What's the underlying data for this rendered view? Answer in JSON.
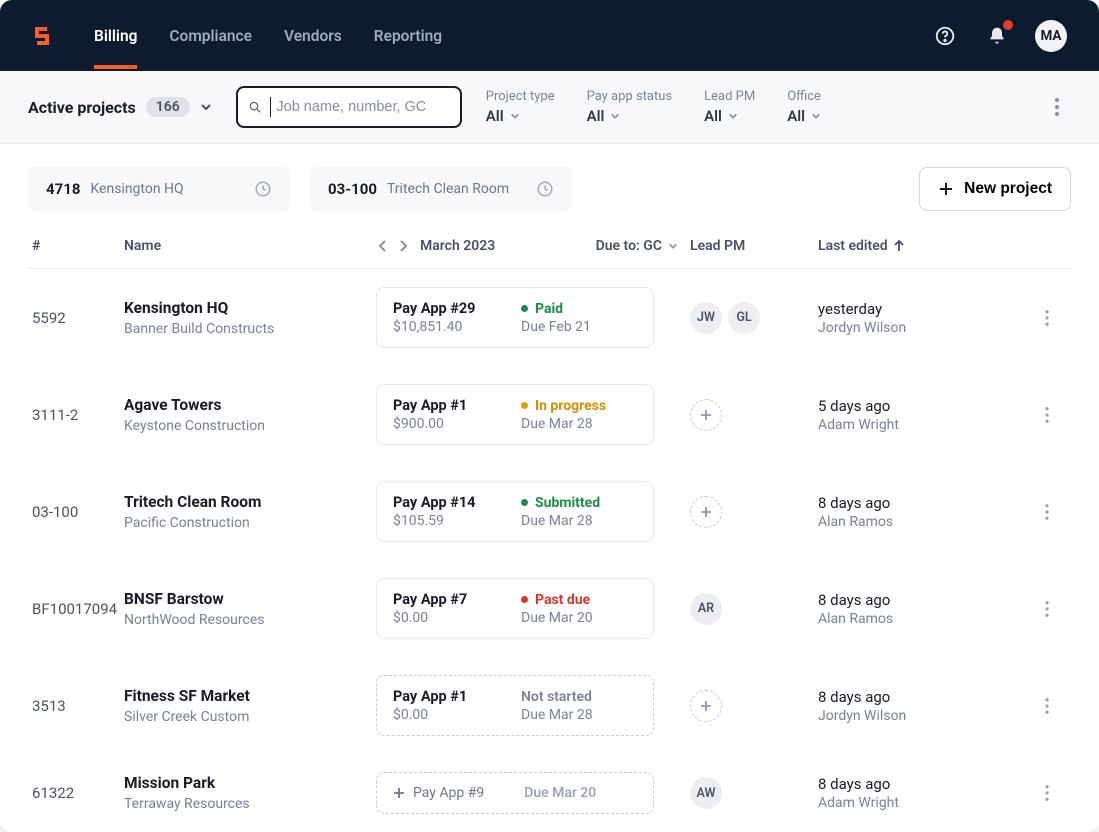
{
  "nav": {
    "links": [
      "Billing",
      "Compliance",
      "Vendors",
      "Reporting"
    ],
    "activeIndex": 0,
    "avatar": "MA"
  },
  "filterbar": {
    "activeProjectsLabel": "Active projects",
    "count": "166",
    "searchPlaceholder": "Job name, number, GC",
    "filters": [
      {
        "label": "Project type",
        "value": "All"
      },
      {
        "label": "Pay app status",
        "value": "All"
      },
      {
        "label": "Lead PM",
        "value": "All"
      },
      {
        "label": "Office",
        "value": "All"
      }
    ]
  },
  "quick": [
    {
      "num": "4718",
      "name": "Kensington HQ"
    },
    {
      "num": "03-100",
      "name": "Tritech Clean Room"
    }
  ],
  "newProjectLabel": "New project",
  "columns": {
    "num": "#",
    "name": "Name",
    "month": "March 2023",
    "dueTo": "Due to: GC",
    "pm": "Lead PM",
    "edited": "Last edited"
  },
  "rows": [
    {
      "num": "5592",
      "name": "Kensington HQ",
      "sub": "Banner Build Constructs",
      "pay": {
        "name": "Pay App #29",
        "amt": "$10,851.40",
        "status": "Paid",
        "statusClass": "paid",
        "showDot": true,
        "due": "Due Feb 21",
        "dashed": false
      },
      "pms": [
        "JW",
        "GL"
      ],
      "edited": {
        "when": "yesterday",
        "who": "Jordyn Wilson"
      }
    },
    {
      "num": "3111-2",
      "name": "Agave Towers",
      "sub": "Keystone Construction",
      "pay": {
        "name": "Pay App #1",
        "amt": "$900.00",
        "status": "In progress",
        "statusClass": "in-progress",
        "showDot": true,
        "due": "Due Mar 28",
        "dashed": false
      },
      "pms": [],
      "edited": {
        "when": "5 days ago",
        "who": "Adam Wright"
      }
    },
    {
      "num": "03-100",
      "name": "Tritech Clean Room",
      "sub": "Pacific Construction",
      "pay": {
        "name": "Pay App #14",
        "amt": "$105.59",
        "status": "Submitted",
        "statusClass": "submitted",
        "showDot": true,
        "due": "Due Mar 28",
        "dashed": false
      },
      "pms": [],
      "edited": {
        "when": "8 days ago",
        "who": "Alan Ramos"
      }
    },
    {
      "num": "BF10017094",
      "name": "BNSF Barstow",
      "sub": "NorthWood Resources",
      "pay": {
        "name": "Pay App #7",
        "amt": "$0.00",
        "status": "Past due",
        "statusClass": "past-due",
        "showDot": true,
        "due": "Due Mar 20",
        "dashed": false
      },
      "pms": [
        "AR"
      ],
      "edited": {
        "when": "8 days ago",
        "who": "Alan Ramos"
      }
    },
    {
      "num": "3513",
      "name": "Fitness SF Market",
      "sub": "Silver Creek Custom",
      "pay": {
        "name": "Pay App #1",
        "amt": "$0.00",
        "status": "Not started",
        "statusClass": "not-started",
        "showDot": false,
        "due": "Due Mar 28",
        "dashed": true
      },
      "pms": [],
      "edited": {
        "when": "8 days ago",
        "who": "Jordyn Wilson"
      }
    },
    {
      "num": "61322",
      "name": "Mission Park",
      "sub": "Terraway Resources",
      "addPay": {
        "label": "Pay App #9",
        "due": "Due Mar 20"
      },
      "pms": [
        "AW"
      ],
      "edited": {
        "when": "8 days ago",
        "who": "Adam Wright"
      }
    }
  ]
}
